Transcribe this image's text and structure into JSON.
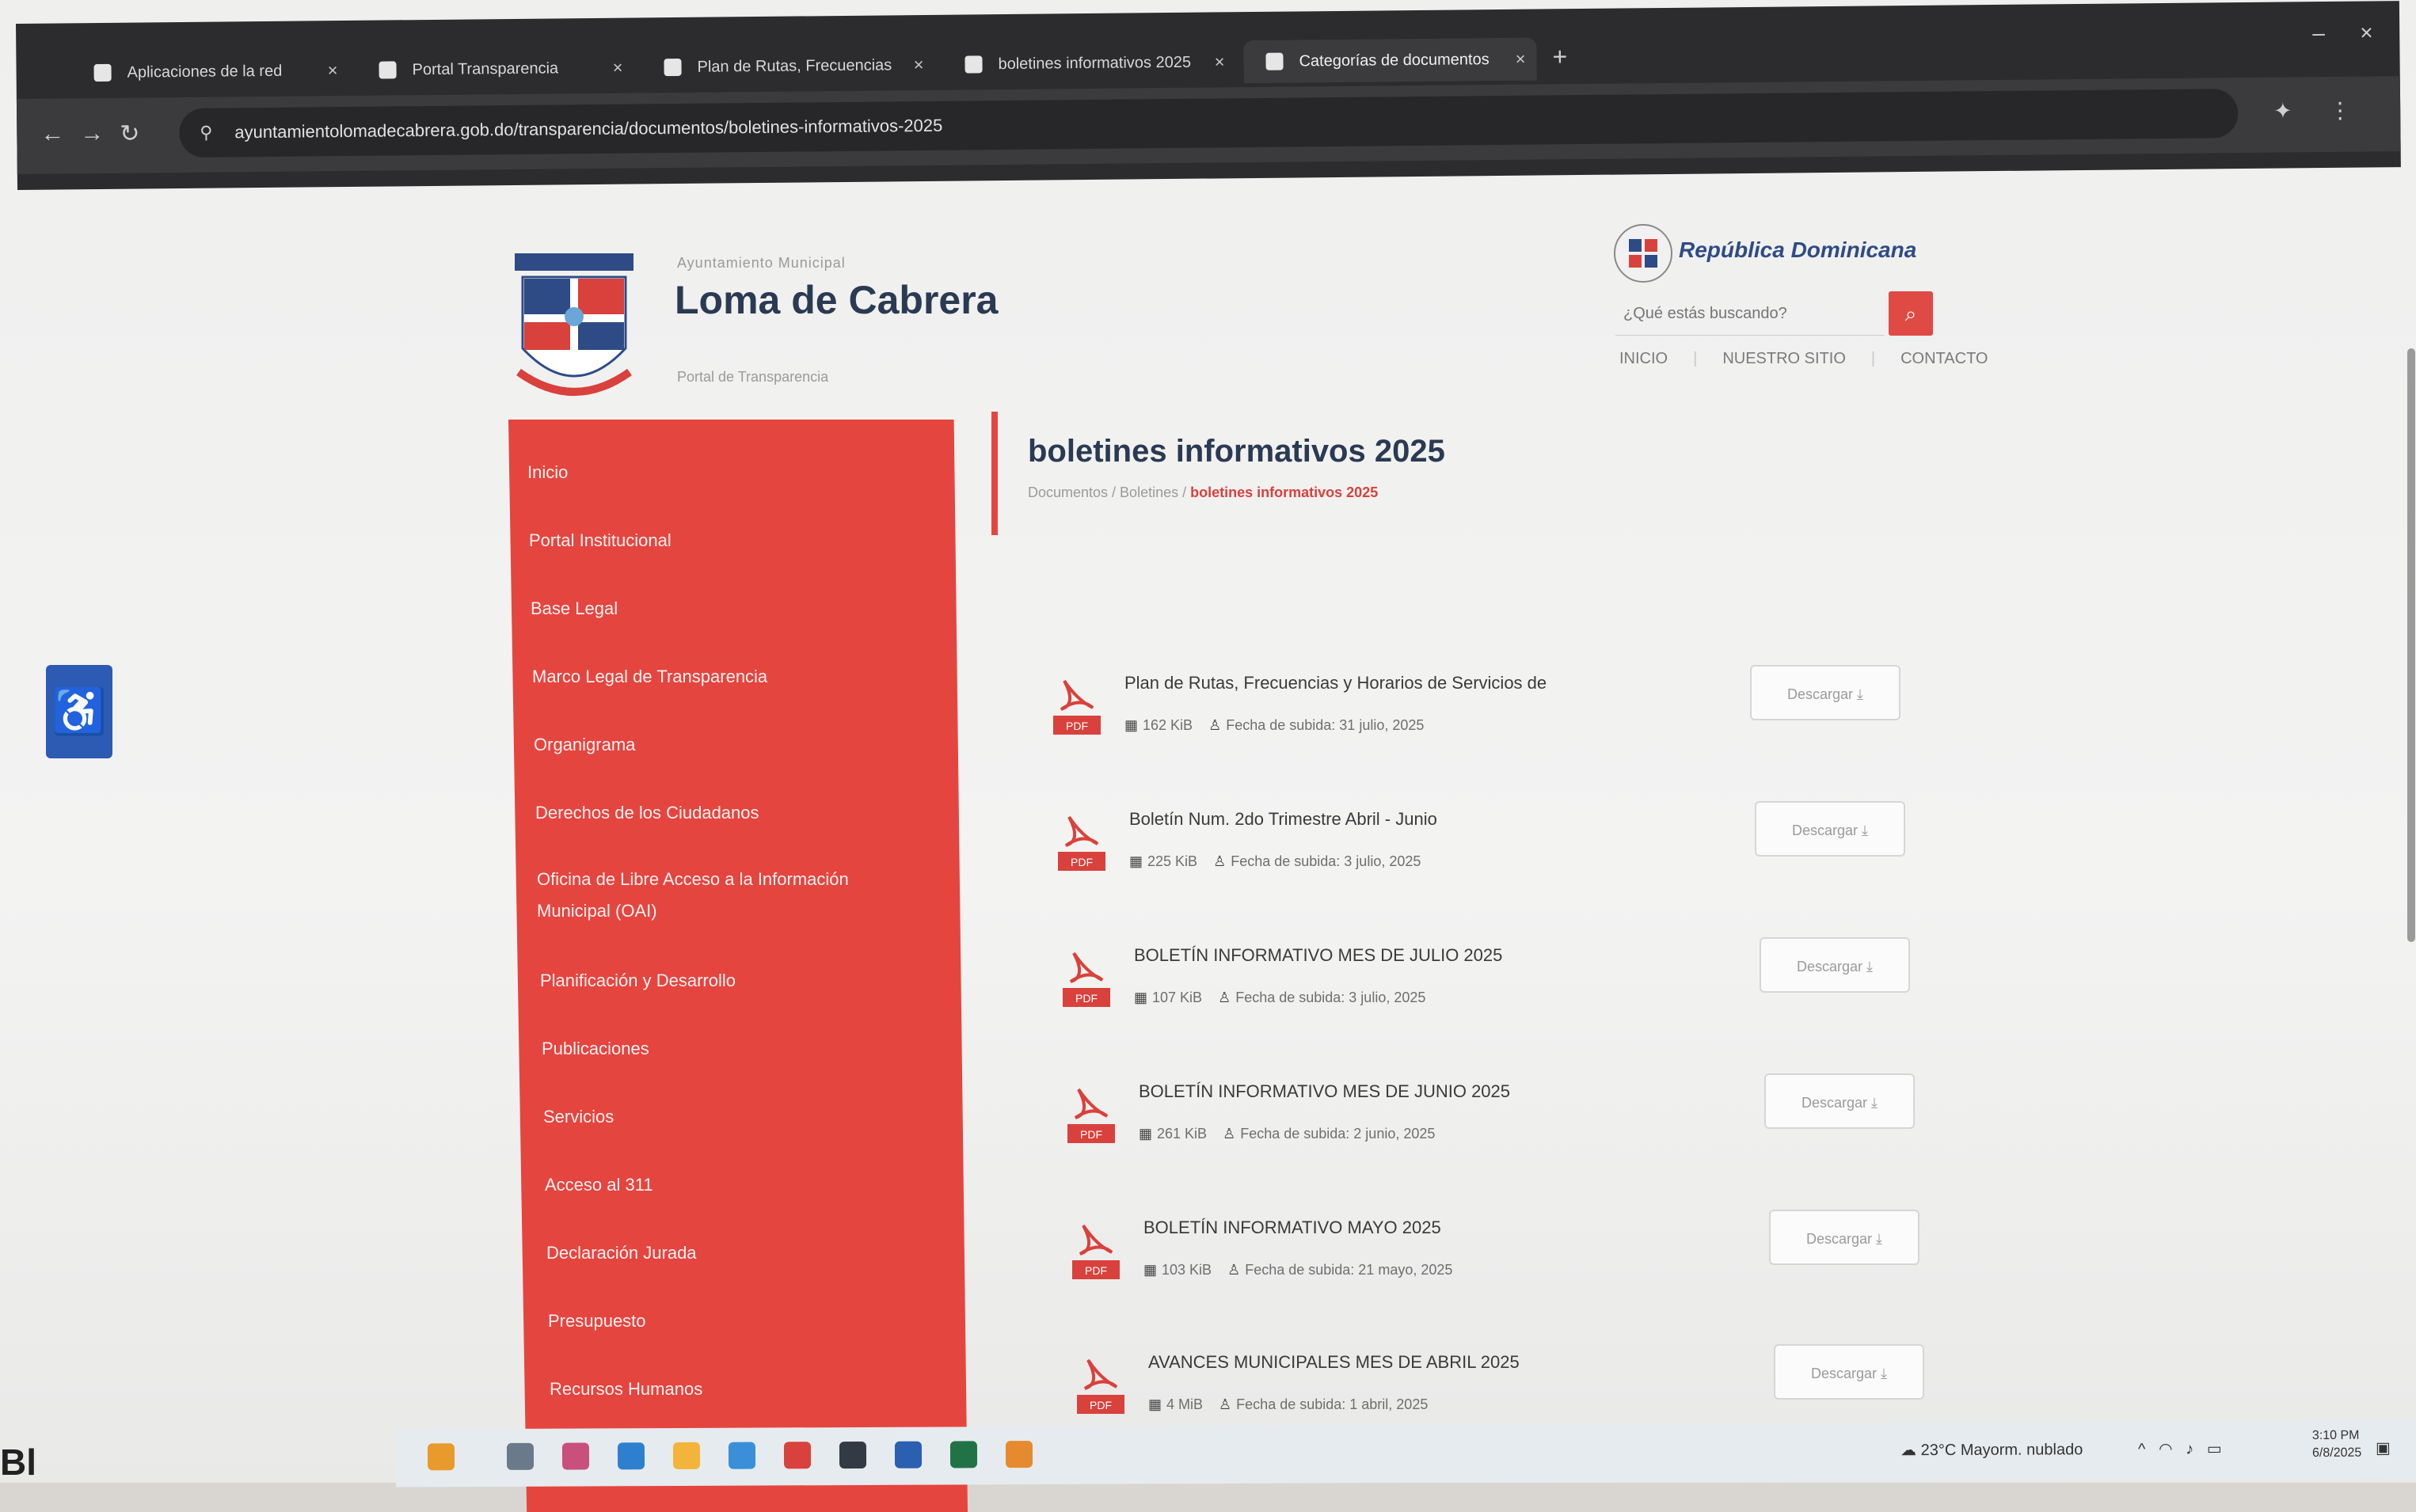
{
  "browser": {
    "tabs": [
      {
        "label": "Aplicaciones de la red"
      },
      {
        "label": "Portal Transparencia"
      },
      {
        "label": "Plan de Rutas, Frecuencias"
      },
      {
        "label": "boletines informativos 2025"
      },
      {
        "label": "Categorías de documentos"
      }
    ],
    "new_tab": "+",
    "url": "ayuntamientolomadecabrera.gob.do/transparencia/documentos/boletines-informativos-2025"
  },
  "site": {
    "kicker": "Ayuntamiento Municipal",
    "name": "Loma de Cabrera",
    "sub": "Portal de Transparencia",
    "gov_name": "República Dominicana",
    "search_placeholder": "¿Qué estás buscando?",
    "search_icon": "search-icon",
    "top_links": [
      "INICIO",
      "NUESTRO SITIO",
      "CONTACTO"
    ]
  },
  "sidebar": {
    "items": [
      "Inicio",
      "Portal Institucional",
      "Base Legal",
      "Marco Legal de Transparencia",
      "Organigrama",
      "Derechos de los Ciudadanos",
      "Oficina de Libre Acceso a la Información",
      "Municipal (OAI)",
      "Planificación y Desarrollo",
      "Publicaciones",
      "Servicios",
      "Acceso al 311",
      "Declaración Jurada",
      "Presupuesto",
      "Recursos Humanos"
    ]
  },
  "content": {
    "title": "boletines informativos 2025",
    "breadcrumb_path": "Documentos / Boletines",
    "breadcrumb_current": "boletines informativos 2025",
    "documents": [
      {
        "title": "Plan de Rutas, Frecuencias y Horarios de Servicios de",
        "size": "162 KiB",
        "date": "Fecha de subida: 31 julio, 2025",
        "download": "Descargar"
      },
      {
        "title": "Boletín Num. 2do Trimestre Abril - Junio",
        "size": "225 KiB",
        "date": "Fecha de subida: 3 julio, 2025",
        "download": "Descargar"
      },
      {
        "title": "BOLETÍN INFORMATIVO MES DE JULIO 2025",
        "size": "107 KiB",
        "date": "Fecha de subida: 3 julio, 2025",
        "download": "Descargar"
      },
      {
        "title": "BOLETÍN INFORMATIVO MES DE JUNIO 2025",
        "size": "261 KiB",
        "date": "Fecha de subida: 2 junio, 2025",
        "download": "Descargar"
      },
      {
        "title": "BOLETÍN INFORMATIVO MAYO 2025",
        "size": "103 KiB",
        "date": "Fecha de subida: 21 mayo, 2025",
        "download": "Descargar"
      },
      {
        "title": "AVANCES MUNICIPALES MES DE ABRIL 2025",
        "size": "4 MiB",
        "date": "Fecha de subida: 1 abril, 2025",
        "download": "Descargar"
      }
    ],
    "pdf_badge": "PDF"
  },
  "taskbar": {
    "weather": "23°C Mayorm. nublado",
    "time": "3:10 PM",
    "date": "6/8/2025",
    "desk_text": "Bl"
  },
  "colors": {
    "accent_red": "#e5453f",
    "navy": "#2a3a52",
    "chrome_dark": "#2c2c2e"
  }
}
